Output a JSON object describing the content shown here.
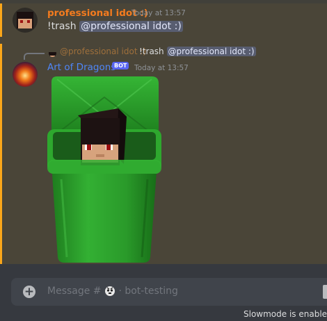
{
  "messages": [
    {
      "username": "professional idot :)",
      "timestamp": "Today at 13:57",
      "command": "!trash",
      "mention": "@professional idot :)"
    },
    {
      "reply": {
        "username": "@professional idot :)",
        "text": "!trash",
        "mention": "@professional idot :)"
      },
      "username": "Art of Dragons",
      "bot_tag": "BOT",
      "timestamp": "Today at 13:57"
    }
  ],
  "composer": {
    "placeholder_prefix": "Message #",
    "channel": "· bot-testing"
  },
  "slowmode_text": "Slowmode is enabled, l",
  "colors": {
    "accent": "#faa61a",
    "username_1": "#f47b1e",
    "username_2": "#4f86f7",
    "bot_tag": "#5865f2",
    "trash_can": "#2a9a2a"
  }
}
